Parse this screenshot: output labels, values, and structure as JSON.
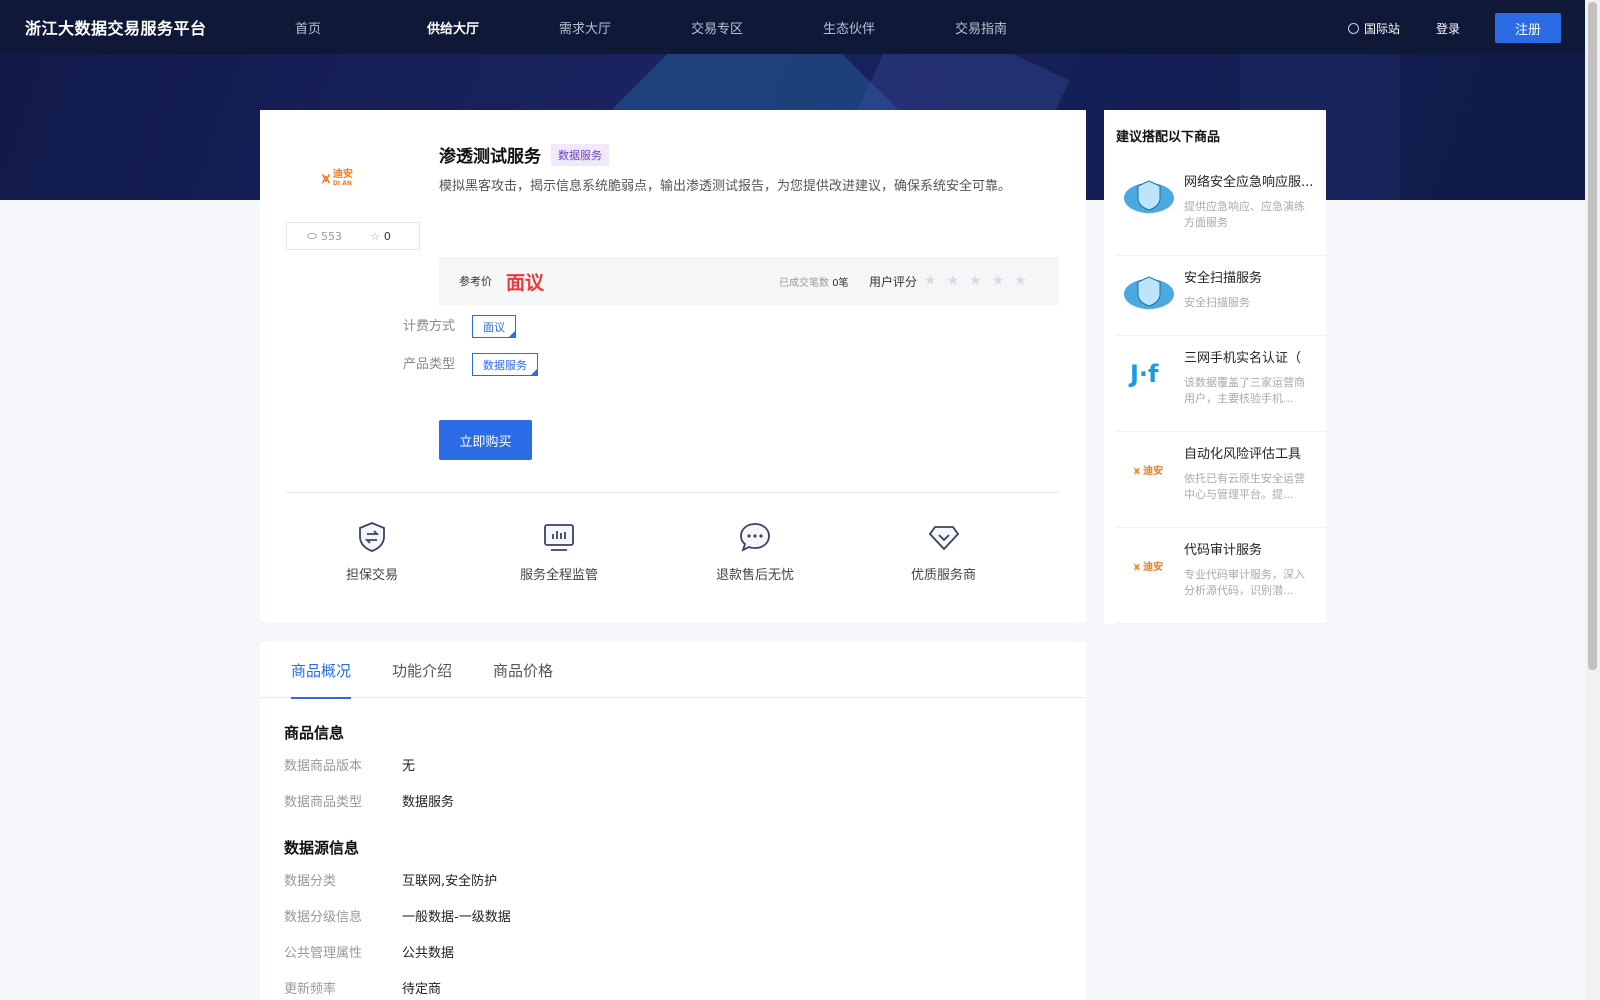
{
  "nav": {
    "brand": "浙江大数据交易服务平台",
    "items": [
      "首页",
      "供给大厅",
      "需求大厅",
      "交易专区",
      "生态伙伴",
      "交易指南"
    ],
    "active_index": 1,
    "intl": "国际站",
    "login": "登录",
    "register": "注册"
  },
  "product": {
    "logo_text": "迪安",
    "logo_sub": "DI AN",
    "views": "553",
    "favorites": "0",
    "title": "渗透测试服务",
    "category_tag": "数据服务",
    "description": "模拟黑客攻击，揭示信息系统脆弱点，输出渗透测试报告，为您提供改进建议，确保系统安全可靠。",
    "price_label": "参考价",
    "price_value": "面议",
    "deals_label": "已成交笔数",
    "deals_value": "0笔",
    "rating_label": "用户评分",
    "billing_label": "计费方式",
    "billing_value": "面议",
    "type_label": "产品类型",
    "type_value": "数据服务",
    "buy_label": "立即购买"
  },
  "features": [
    {
      "label": "担保交易",
      "icon": "shield-exchange-icon"
    },
    {
      "label": "服务全程监管",
      "icon": "monitor-chart-icon"
    },
    {
      "label": "退款售后无忧",
      "icon": "chat-bubble-icon"
    },
    {
      "label": "优质服务商",
      "icon": "diamond-icon"
    }
  ],
  "side": {
    "title": "建议搭配以下商品",
    "items": [
      {
        "name": "网络安全应急响应服...",
        "desc": "提供应急响应、应急演练方面服务",
        "logo": "cloud-shield-logo"
      },
      {
        "name": "安全扫描服务",
        "desc": "安全扫描服务",
        "logo": "cloud-shield-logo"
      },
      {
        "name": "三网手机实名认证（",
        "desc": "该数据覆盖了三家运营商用户，主要核验手机...",
        "logo": "jf-logo"
      },
      {
        "name": "自动化风险评估工具",
        "desc": "依托已有云原生安全运营中心与管理平台。提...",
        "logo": "dian-logo"
      },
      {
        "name": "代码审计服务",
        "desc": "专业代码审计服务，深入分析源代码，识别潜...",
        "logo": "dian-logo"
      }
    ]
  },
  "tabs": [
    "商品概况",
    "功能介绍",
    "商品价格"
  ],
  "active_tab": 0,
  "sections": [
    {
      "title": "商品信息",
      "rows": [
        {
          "k": "数据商品版本",
          "v": "无"
        },
        {
          "k": "数据商品类型",
          "v": "数据服务"
        }
      ]
    },
    {
      "title": "数据源信息",
      "rows": [
        {
          "k": "数据分类",
          "v": "互联网,安全防护"
        },
        {
          "k": "数据分级信息",
          "v": "一般数据-一级数据"
        },
        {
          "k": "公共管理属性",
          "v": "公共数据"
        },
        {
          "k": "更新频率",
          "v": "待定商"
        }
      ]
    }
  ],
  "colors": {
    "accent": "#2b6ce6",
    "price": "#e83a3a",
    "nav_bg": "#0f1836"
  }
}
